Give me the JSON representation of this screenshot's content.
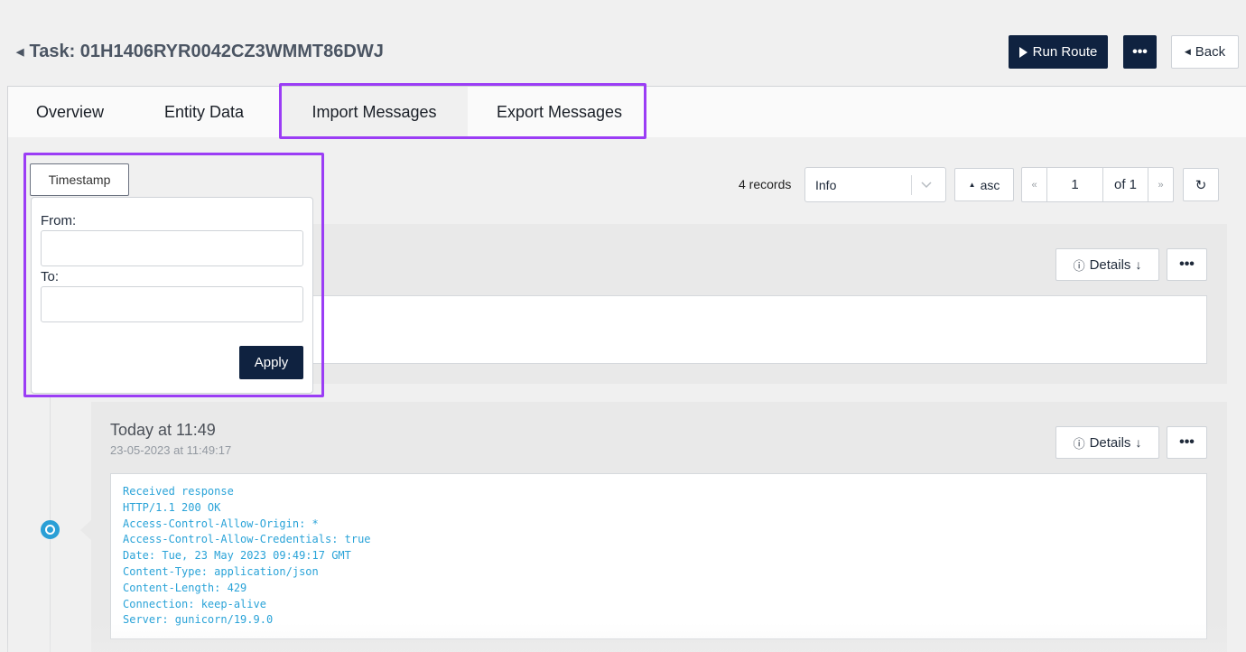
{
  "header": {
    "title": "Task: 01H1406RYR0042CZ3WMMT86DWJ",
    "run_route_label": "Run Route",
    "more_label": "•••",
    "back_label": "Back"
  },
  "tabs": [
    {
      "label": "Overview"
    },
    {
      "label": "Entity Data"
    },
    {
      "label": "Import Messages",
      "active": true
    },
    {
      "label": "Export Messages"
    }
  ],
  "filters": {
    "timestamp_label": "Timestamp",
    "from_label": "From:",
    "to_label": "To:",
    "from_value": "",
    "to_value": "",
    "apply_label": "Apply",
    "records_label": "4 records",
    "level_value": "Info",
    "sort_label": "asc",
    "page_value": "1",
    "page_of": "of 1"
  },
  "messages": [
    {
      "details_label": "Details",
      "more_label": "•••"
    },
    {
      "title": "Today at 11:49",
      "subtitle": "23-05-2023 at 11:49:17",
      "details_label": "Details",
      "more_label": "•••",
      "body": "Received response\nHTTP/1.1 200 OK\nAccess-Control-Allow-Origin: *\nAccess-Control-Allow-Credentials: true\nDate: Tue, 23 May 2023 09:49:17 GMT\nContent-Type: application/json\nContent-Length: 429\nConnection: keep-alive\nServer: gunicorn/19.9.0"
    }
  ],
  "colors": {
    "primary": "#0f2240",
    "highlight": "#9b3df5",
    "log_text": "#2aa3d8",
    "timeline_dot": "#2a9fd6"
  }
}
